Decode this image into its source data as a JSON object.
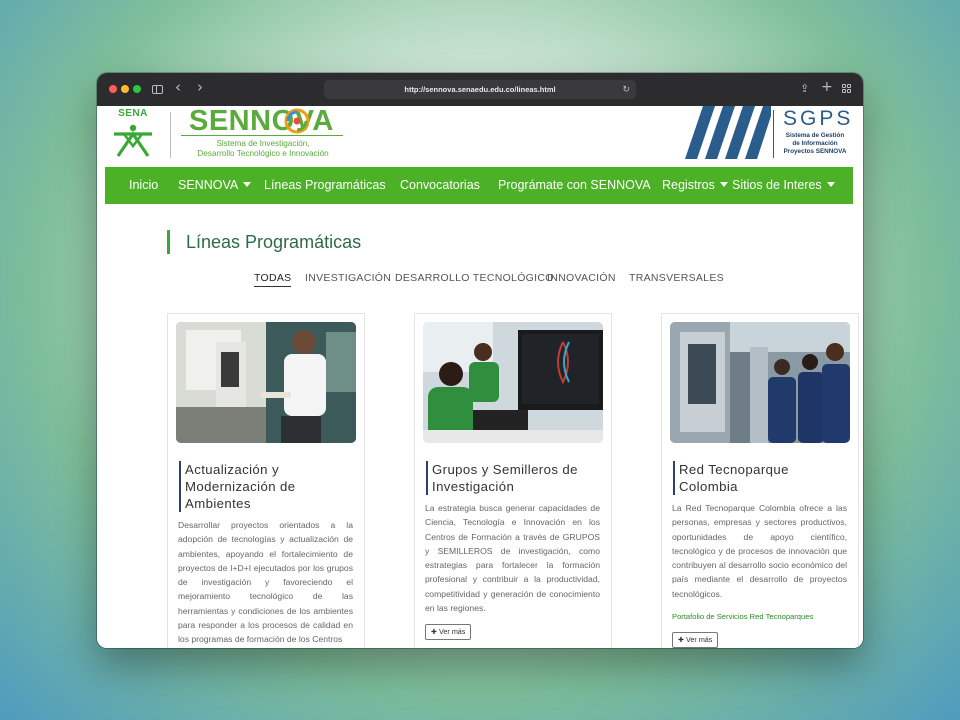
{
  "browser": {
    "url": "http://sennova.senaedu.edu.co/lineas.html"
  },
  "header": {
    "sena_word": "SENA",
    "sennova_title": "SENNOVA",
    "sennova_subtitle_1": "Sistema de Investigación,",
    "sennova_subtitle_2": "Desarrollo Tecnológico e Innovación",
    "sgps_title": "SGPS",
    "sgps_sub_1": "Sistema de Gestión",
    "sgps_sub_2": "de Información",
    "sgps_sub_3": "Proyectos SENNOVA",
    "brand_green": "#4db128",
    "brand_blue": "#2a5d8c"
  },
  "nav": {
    "items": [
      {
        "label": "Inicio",
        "dropdown": false
      },
      {
        "label": "SENNOVA",
        "dropdown": true
      },
      {
        "label": "Líneas Programáticas",
        "dropdown": false
      },
      {
        "label": "Convocatorias",
        "dropdown": false
      },
      {
        "label": "Prográmate con SENNOVA",
        "dropdown": false
      },
      {
        "label": "Registros",
        "dropdown": true
      },
      {
        "label": "Sitios de Interes",
        "dropdown": true
      }
    ]
  },
  "section": {
    "title": "Líneas Programáticas",
    "filters": [
      "TODAS",
      "INVESTIGACIÓN",
      "DESARROLLO TECNOLÓGICO",
      "INNOVACIÓN",
      "TRANSVERSALES"
    ],
    "active_filter": "TODAS"
  },
  "cards": [
    {
      "title_1": "Actualización y",
      "title_2": "Modernización de",
      "title_3": "Ambientes",
      "description": "Desarrollar proyectos orientados a la adopción de tecnologías y actualización de ambientes, apoyando el fortalecimiento de proyectos de I+D+I ejecutados por los grupos de investigación y favoreciendo el mejoramiento tecnológico de las herramientas y condiciones de los ambientes para responder a los procesos de calidad en los programas de formación de los Centros"
    },
    {
      "title_1": "Grupos y Semilleros de",
      "title_2": "Investigación",
      "description": "La estrategia busca generar capacidades de Ciencia, Tecnología e Innovación en los Centros de Formación a través de GRUPOS y SEMILLEROS de investigación, como estrategias para fortalecer la formación profesional y contribuir a la productividad, competitividad y generación de conocimiento en las regiones.",
      "button": "Ver más"
    },
    {
      "title_1": "Red Tecnoparque",
      "title_2": "Colombia",
      "description": "La Red Tecnoparque Colombia ofrece a las personas, empresas y sectores productivos, oportunidades de apoyo científico, tecnológico y de procesos de innovación que contribuyen al desarrollo socio económico del país mediante el desarrollo de proyectos tecnológicos.",
      "link": "Portafolio de Servicios Red Tecnoparques",
      "button": "Ver más"
    }
  ]
}
